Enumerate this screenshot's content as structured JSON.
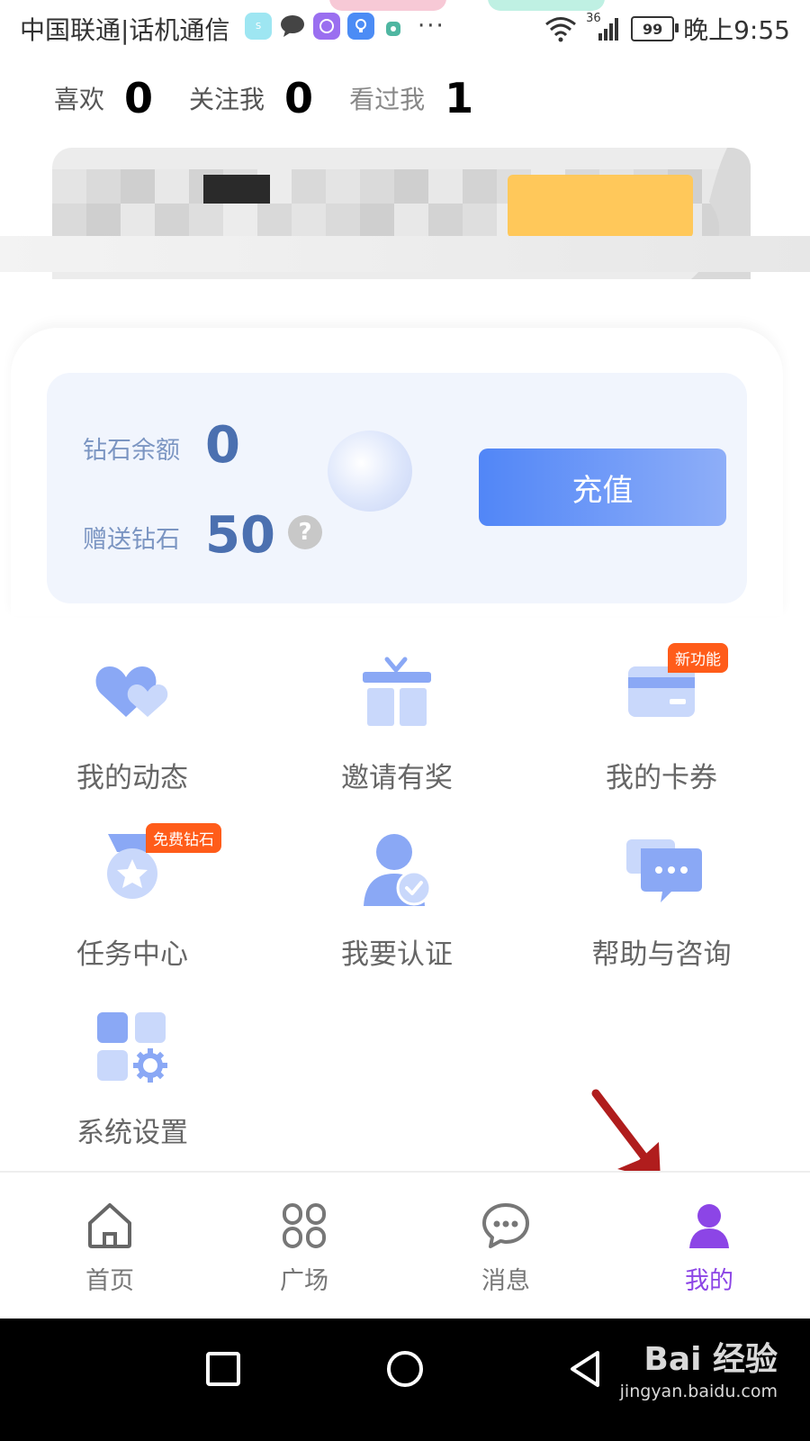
{
  "status_bar": {
    "carrier": "中国联通|话机通信",
    "network": "36",
    "battery": "99",
    "time": "晚上9:55"
  },
  "stats": [
    {
      "label": "喜欢",
      "value": "0"
    },
    {
      "label": "关注我",
      "value": "0"
    },
    {
      "label": "看过我",
      "value": "1"
    }
  ],
  "wallet": {
    "balance_label": "钻石余额",
    "balance_value": "0",
    "gift_label": "赠送钻石",
    "gift_value": "50",
    "help": "?",
    "recharge_label": "充值"
  },
  "features": [
    {
      "label": "我的动态",
      "icon": "hearts-icon"
    },
    {
      "label": "邀请有奖",
      "icon": "gift-icon"
    },
    {
      "label": "我的卡券",
      "icon": "card-icon",
      "badge": "新功能"
    },
    {
      "label": "任务中心",
      "icon": "medal-icon",
      "badge": "免费钻石"
    },
    {
      "label": "我要认证",
      "icon": "verified-user-icon"
    },
    {
      "label": "帮助与咨询",
      "icon": "chat-bubbles-icon"
    },
    {
      "label": "系统设置",
      "icon": "settings-grid-icon"
    }
  ],
  "bottom_nav": [
    {
      "label": "首页",
      "icon": "home-icon"
    },
    {
      "label": "广场",
      "icon": "plaza-icon"
    },
    {
      "label": "消息",
      "icon": "message-icon"
    },
    {
      "label": "我的",
      "icon": "profile-icon",
      "active": true
    }
  ],
  "watermark": {
    "brand": "Bai 经验",
    "url": "jingyan.baidu.com"
  },
  "colors": {
    "accent": "#5186f7",
    "icon_blue": "#8aa8f5",
    "icon_light": "#c9d8fb",
    "active_nav": "#8c45e6",
    "badge": "#ff5c1a",
    "annotation_arrow": "#b01d1d"
  }
}
